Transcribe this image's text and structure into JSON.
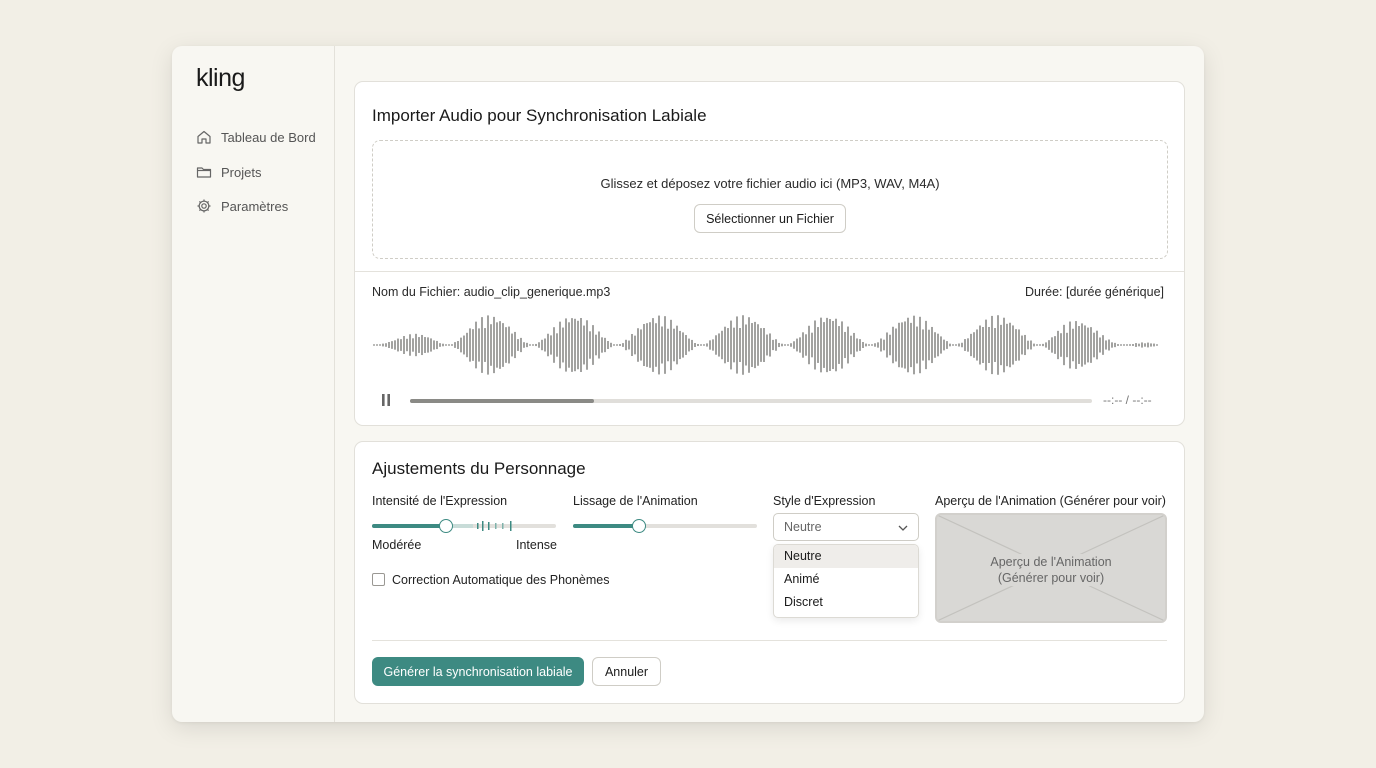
{
  "app": {
    "logo": "kling",
    "accent_color": "#3d8a82"
  },
  "sidebar": {
    "items": [
      {
        "label": "Tableau de Bord",
        "icon": "home-icon"
      },
      {
        "label": "Projets",
        "icon": "folder-icon"
      },
      {
        "label": "Paramètres",
        "icon": "gear-icon"
      }
    ]
  },
  "upload": {
    "title": "Importer Audio pour Synchronisation Labiale",
    "dropzone_text": "Glissez et déposez votre fichier audio ici (MP3, WAV, M4A)",
    "select_button": "Sélectionner un Fichier",
    "file_name": "Nom du Fichier: audio_clip_generique.mp3",
    "duration": "Durée: [durée générique]",
    "player": {
      "time": "--:-- / --:--",
      "progress": 0.27,
      "pause_icon": "pause-icon"
    }
  },
  "character": {
    "title": "Ajustements du Personnage",
    "expression_intensity": {
      "label": "Intensité de l'Expression",
      "value": 0.4,
      "min_label": "Modérée",
      "max_label": "Intense"
    },
    "animation_smoothing": {
      "label": "Lissage de l'Animation",
      "value": 0.36
    },
    "expression_style": {
      "label": "Style d'Expression",
      "selected": "Neutre",
      "options": [
        "Neutre",
        "Animé",
        "Discret"
      ]
    },
    "preview": {
      "label": "Aperçu de l'Animation (Générer pour voir)",
      "placeholder_line1": "Aperçu de l'Animation",
      "placeholder_line2": "(Générer pour voir)"
    },
    "auto_phoneme": {
      "label": "Correction Automatique des Phonèmes",
      "checked": false
    }
  },
  "actions": {
    "generate": "Générer la synchronisation labiale",
    "cancel": "Annuler"
  }
}
